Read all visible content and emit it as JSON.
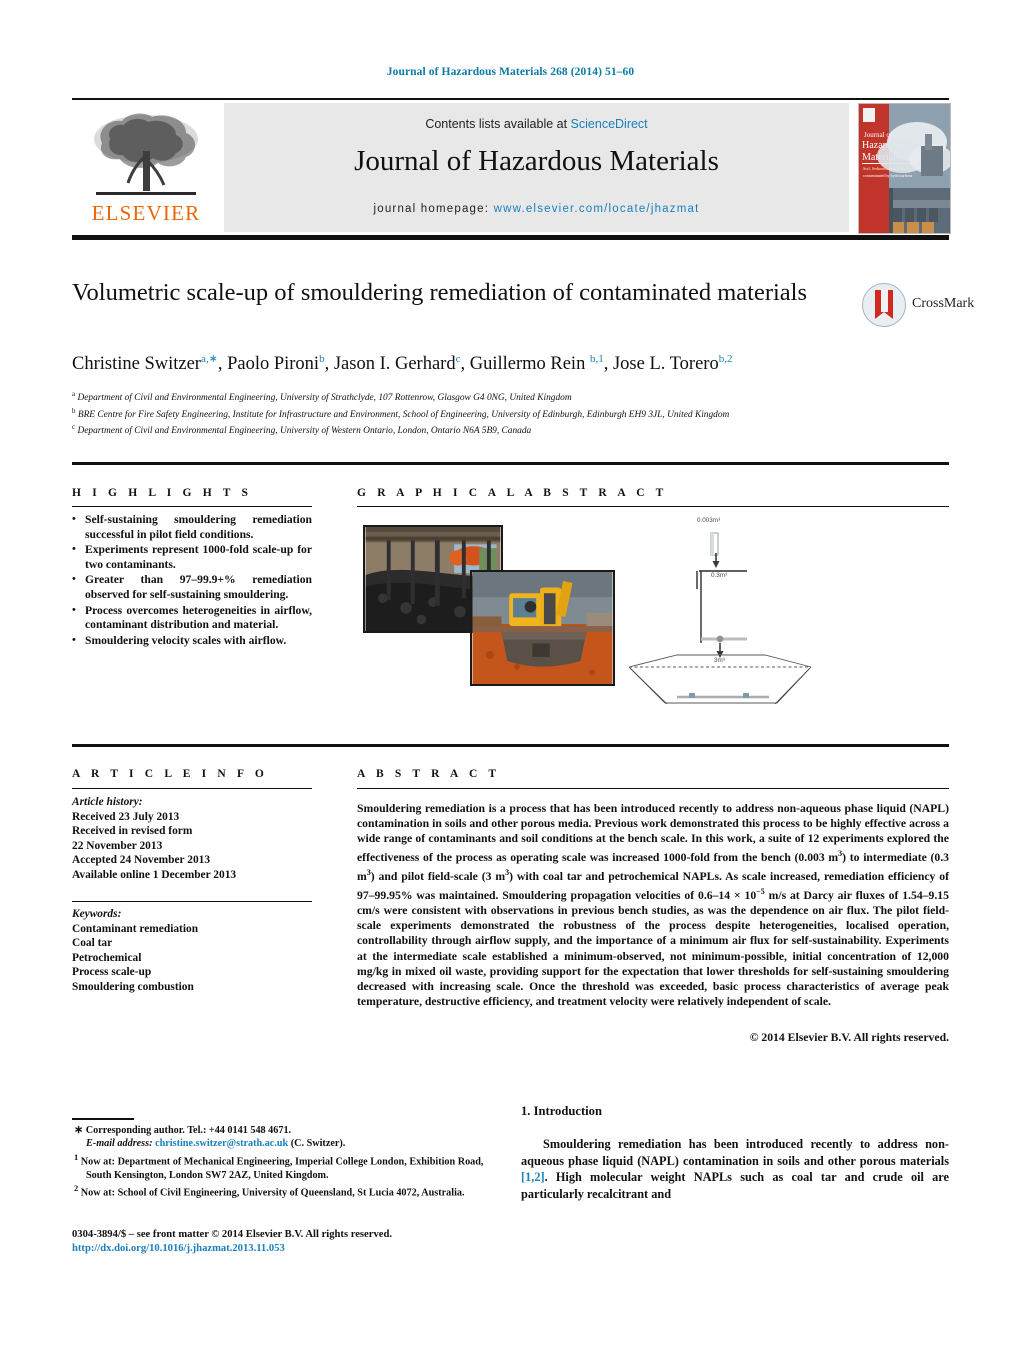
{
  "running_head": "Journal of Hazardous Materials 268 (2014) 51–60",
  "masthead": {
    "contents_prefix": "Contents lists available at ",
    "sciencedirect": "ScienceDirect",
    "journal_title": "Journal of Hazardous Materials",
    "homepage_prefix": "journal homepage:",
    "homepage_url": "www.elsevier.com/locate/jhazmat",
    "publisher": "ELSEVIER",
    "cover_title_1": "Journal of",
    "cover_title_2": "Hazardous",
    "cover_title_3": "Materials"
  },
  "article": {
    "title": "Volumetric scale-up of smouldering remediation of contaminated materials",
    "authors_html": "Christine Switzer<sup>a,∗</sup>, Paolo Pironi<sup>b</sup>, Jason I. Gerhard<sup>c</sup>, Guillermo Rein <sup>b,1</sup>, Jose L. Torero<sup>b,2</sup>",
    "affiliations": [
      "Department of Civil and Environmental Engineering, University of Strathclyde, 107 Rottenrow, Glasgow G4 0NG, United Kingdom",
      "BRE Centre for Fire Safety Engineering, Institute for Infrastructure and Environment, School of Engineering, University of Edinburgh, Edinburgh EH9 3JL, United Kingdom",
      "Department of Civil and Environmental Engineering, University of Western Ontario, London, Ontario N6A 5B9, Canada"
    ],
    "affiliation_marks": [
      "a",
      "b",
      "c"
    ],
    "crossmark_label": "CrossMark"
  },
  "sections": {
    "highlights_head": "H I G H L I G H T S",
    "graphical_abstract_head": "G R A P H I C A L   A B S T R A C T",
    "article_info_head": "A R T I C L E    I N F O",
    "abstract_head": "A B S T R A C T"
  },
  "highlights": [
    "Self-sustaining smouldering remediation successful in pilot field conditions.",
    "Experiments represent 1000-fold scale-up for two contaminants.",
    "Greater than 97–99.9+% remediation observed for self-sustaining smouldering.",
    "Process overcomes heterogeneities in airflow, contaminant distribution and material.",
    "Smouldering velocity scales with airflow."
  ],
  "graphical_abstract": {
    "diagram_labels": [
      "0.003m³",
      "0.3m³",
      "3m³"
    ],
    "photo_a_caption": "bench-excavation-photo",
    "photo_b_caption": "excavator-bucket-photo"
  },
  "article_info": {
    "history_label": "Article history:",
    "history": [
      "Received 23 July 2013",
      "Received in revised form",
      "22 November 2013",
      "Accepted 24 November 2013",
      "Available online 1 December 2013"
    ],
    "keywords_label": "Keywords:",
    "keywords": [
      "Contaminant remediation",
      "Coal tar",
      "Petrochemical",
      "Process scale-up",
      "Smouldering combustion"
    ]
  },
  "abstract": {
    "text_html": "Smouldering remediation is a process that has been introduced recently to address non-aqueous phase liquid (NAPL) contamination in soils and other porous media. Previous work demonstrated this process to be highly effective across a wide range of contaminants and soil conditions at the bench scale. In this work, a suite of 12 experiments explored the effectiveness of the process as operating scale was increased 1000-fold from the bench (0.003 m<sup>3</sup>) to intermediate (0.3 m<sup>3</sup>) and pilot field-scale (3 m<sup>3</sup>) with coal tar and petrochemical NAPLs. As scale increased, remediation efficiency of 97–99.95% was maintained. Smouldering propagation velocities of 0.6–14 × 10<sup>−5</sup> m/s at Darcy air fluxes of 1.54–9.15 cm/s were consistent with observations in previous bench studies, as was the dependence on air flux. The pilot field-scale experiments demonstrated the robustness of the process despite heterogeneities, localised operation, controllability through airflow supply, and the importance of a minimum air flux for self-sustainability. Experiments at the intermediate scale established a minimum-observed, not minimum-possible, initial concentration of 12,000 mg/kg in mixed oil waste, providing support for the expectation that lower thresholds for self-sustaining smouldering decreased with increasing scale. Once the threshold was exceeded, basic process characteristics of average peak temperature, destructive efficiency, and treatment velocity were relatively independent of scale.",
    "copyright": "© 2014  Elsevier B.V. All rights reserved."
  },
  "footnotes": {
    "corresponding_html": "<span style=\"font-size:11px\">∗</span> Corresponding author. Tel.: +44 0141 548 4671.",
    "email_label": "E-mail address:",
    "email": "christine.switzer@strath.ac.uk",
    "email_suffix": "(C. Switzer).",
    "note1": "Now at: Department of Mechanical Engineering, Imperial College London, Exhibition Road, South Kensington, London SW7 2AZ, United Kingdom.",
    "note2": "Now at: School of Civil Engineering, University of Queensland, St Lucia 4072, Australia.",
    "note1_mark": "1",
    "note2_mark": "2"
  },
  "imprint": {
    "issn_line": "0304-3894/$ – see front matter © 2014  Elsevier B.V. All rights reserved.",
    "doi": "http://dx.doi.org/10.1016/j.jhazmat.2013.11.053"
  },
  "introduction": {
    "heading": "1. Introduction",
    "paragraph_html": "Smouldering remediation has been introduced recently to address non-aqueous phase liquid (NAPL) contamination in soils and other porous materials <span class=\"cite\">[1,2]</span>. High molecular weight NAPLs such as coal tar and crude oil are particularly recalcitrant and"
  },
  "colors": {
    "link": "#1a7fbd",
    "elsevier_orange": "#eb6608",
    "panel_grey": "#e8e8e8",
    "rule_black": "#111111"
  }
}
